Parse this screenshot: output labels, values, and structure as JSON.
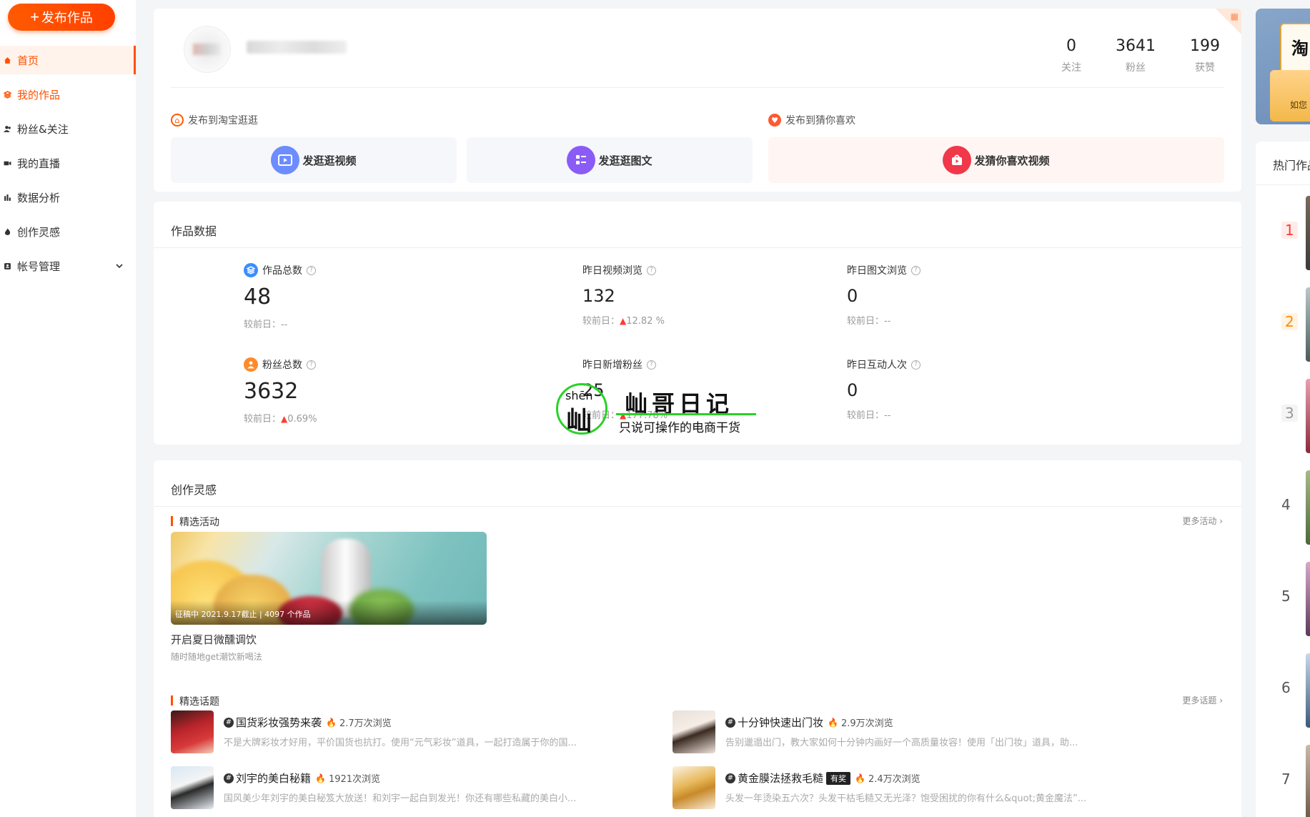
{
  "sidebar": {
    "publish_label": "发布作品",
    "items": [
      {
        "label": "首页",
        "icon": "home-icon"
      },
      {
        "label": "我的作品",
        "icon": "layers-icon"
      },
      {
        "label": "粉丝&关注",
        "icon": "users-icon"
      },
      {
        "label": "我的直播",
        "icon": "video-icon"
      },
      {
        "label": "数据分析",
        "icon": "bar-chart-icon"
      },
      {
        "label": "创作灵感",
        "icon": "flame-icon"
      },
      {
        "label": "帐号管理",
        "icon": "id-card-icon"
      }
    ]
  },
  "profile": {
    "stats": [
      {
        "value": "0",
        "label": "关注"
      },
      {
        "value": "3641",
        "label": "粉丝"
      },
      {
        "value": "199",
        "label": "获赞"
      }
    ],
    "publish_taobao_title": "发布到淘宝逛逛",
    "publish_guess_title": "发布到猜你喜欢",
    "btn_video": "发逛逛视频",
    "btn_graphic": "发逛逛图文",
    "btn_guess_video": "发猜你喜欢视频"
  },
  "data_section": {
    "title": "作品数据",
    "compare_label": "较前日：",
    "metrics": [
      {
        "label": "作品总数",
        "value": "48",
        "change": "--"
      },
      {
        "label": "昨日视频浏览",
        "value": "132",
        "change": "12.82 %"
      },
      {
        "label": "昨日图文浏览",
        "value": "0",
        "change": "--"
      },
      {
        "label": "粉丝总数",
        "value": "3632",
        "change": "0.69%"
      },
      {
        "label": "昨日新增粉丝",
        "value": "25",
        "change": "177.78%"
      },
      {
        "label": "昨日互动人次",
        "value": "0",
        "change": "--"
      }
    ]
  },
  "watermark": {
    "pinyin": "shēn",
    "char": "屾",
    "title": "屾哥日记",
    "subtitle": "只说可操作的电商干货"
  },
  "inspiration": {
    "title": "创作灵感",
    "activities_title": "精选活动",
    "more_activities": "更多活动",
    "activity": {
      "caption": "征稿中  2021.9.17截止 | 4097 个作品",
      "name": "开启夏日微醺调饮",
      "desc": "随时随地get潮饮新喝法"
    },
    "topics_title": "精选话题",
    "more_topics": "更多话题",
    "topics": [
      {
        "title": "国货彩妆强势来袭",
        "views": "2.7万次浏览",
        "badge": "",
        "desc": "不是大牌彩妆才好用，平价国货也抗打。使用“元气彩妆”道具，一起打造属于你的国..."
      },
      {
        "title": "十分钟快速出门妆",
        "views": "2.9万次浏览",
        "badge": "",
        "desc": "告别邋遢出门，教大家如何十分钟内画好一个高质量妆容！使用「出门妆」道具，助..."
      },
      {
        "title": "刘宇的美白秘籍",
        "views": "1921次浏览",
        "badge": "",
        "desc": "国风美少年刘宇的美白秘笈大放送！和刘宇一起白到发光！你还有哪些私藏的美白小..."
      },
      {
        "title": "黄金膜法拯救毛糙",
        "views": "2.4万次浏览",
        "badge": "有奖",
        "desc": "头发一年烫染五六次？头发干枯毛糙又无光泽？饱受困扰的你有什么&quot;黄金魔法”..."
      }
    ]
  },
  "right_rail": {
    "banner_char": "淘",
    "banner_text": "如您",
    "hot_title": "热门作品",
    "ranks": [
      "1",
      "2",
      "3",
      "4",
      "5",
      "6",
      "7"
    ]
  },
  "colors": {
    "accent": "#ff5000",
    "video_btn": "#6c8cff",
    "graphic_btn": "#8a5cf5",
    "guess_btn": "#f0384a",
    "up_arrow": "#ff3b30"
  }
}
